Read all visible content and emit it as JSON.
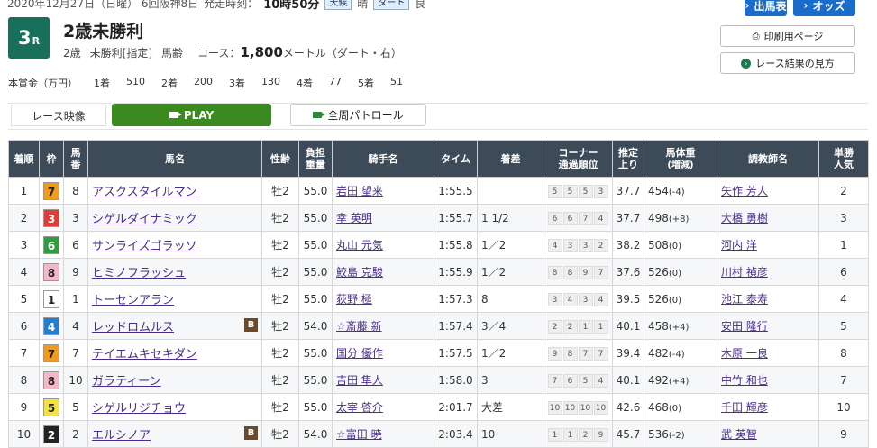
{
  "race": {
    "date_line": "2020年12月27日（日曜） 6回阪神8日",
    "start_label": "発走時刻：",
    "start_time": "10時50分",
    "weather_tag": "天候",
    "weather": "晴",
    "track_tag": "ダート",
    "track_state": "良",
    "number": "3",
    "number_suffix": "R",
    "name": "2歳未勝利",
    "cond_age": "2歳",
    "cond_class": "未勝利[指定]",
    "cond_weight": "馬齢",
    "course_label": "コース：",
    "distance": "1,800",
    "distance_unit": "メートル（ダート・右）"
  },
  "prize": {
    "label": "本賞金（万円）",
    "items": [
      {
        "place": "1着",
        "value": "510"
      },
      {
        "place": "2着",
        "value": "200"
      },
      {
        "place": "3着",
        "value": "130"
      },
      {
        "place": "4着",
        "value": "77"
      },
      {
        "place": "5着",
        "value": "51"
      }
    ]
  },
  "buttons": {
    "entries": "出馬表",
    "odds": "オッズ",
    "print": "印刷用ページ",
    "howto": "レース結果の見方"
  },
  "video": {
    "label": "レース映像",
    "play": "PLAY",
    "patrol": "全周パトロール"
  },
  "headers": {
    "rank": "着順",
    "waku": "枠",
    "num_a": "馬",
    "num_b": "番",
    "horse": "馬名",
    "sexage": "性齢",
    "wt_a": "負担",
    "wt_b": "重量",
    "jockey": "騎手名",
    "time": "タイム",
    "margin": "着差",
    "corner_a": "コーナー",
    "corner_b": "通過順位",
    "last_a": "推定",
    "last_b": "上り",
    "bw_a": "馬体重",
    "bw_b": "(増減)",
    "trainer": "調教師名",
    "pop_a": "単勝",
    "pop_b": "人気"
  },
  "colors": {
    "header_bg": "#3d4a57",
    "race_badge": "#19705a",
    "play_btn": "#3b8a1f",
    "blue_btn": "#1a6ccb"
  },
  "rows": [
    {
      "rank": "1",
      "waku": "7",
      "num": "8",
      "horse": "アスクスタイルマン",
      "blinker": "",
      "sex": "牡2",
      "wt": "55.0",
      "jockey": "岩田 望来",
      "time": "1:55.5",
      "margin": "",
      "corners": [
        "5",
        "5",
        "5",
        "3"
      ],
      "last": "37.7",
      "bw": "454",
      "bwd": "(-4)",
      "trainer": "矢作 芳人",
      "pop": "2"
    },
    {
      "rank": "2",
      "waku": "3",
      "num": "3",
      "horse": "シゲルダイナミック",
      "blinker": "",
      "sex": "牡2",
      "wt": "55.0",
      "jockey": "幸 英明",
      "time": "1:55.7",
      "margin": "1 1/2",
      "corners": [
        "6",
        "6",
        "7",
        "4"
      ],
      "last": "37.7",
      "bw": "498",
      "bwd": "(+8)",
      "trainer": "大橋 勇樹",
      "pop": "3"
    },
    {
      "rank": "3",
      "waku": "6",
      "num": "6",
      "horse": "サンライズゴラッソ",
      "blinker": "",
      "sex": "牡2",
      "wt": "55.0",
      "jockey": "丸山 元気",
      "time": "1:55.8",
      "margin": "1／2",
      "corners": [
        "4",
        "3",
        "3",
        "2"
      ],
      "last": "38.2",
      "bw": "508",
      "bwd": "(0)",
      "trainer": "河内 洋",
      "pop": "1"
    },
    {
      "rank": "4",
      "waku": "8",
      "num": "9",
      "horse": "ヒミノフラッシュ",
      "blinker": "",
      "sex": "牡2",
      "wt": "55.0",
      "jockey": "鮫島 克駿",
      "time": "1:55.9",
      "margin": "1／2",
      "corners": [
        "8",
        "8",
        "9",
        "7"
      ],
      "last": "37.6",
      "bw": "526",
      "bwd": "(0)",
      "trainer": "川村 禎彦",
      "pop": "6"
    },
    {
      "rank": "5",
      "waku": "1",
      "num": "1",
      "horse": "トーセンアラン",
      "blinker": "",
      "sex": "牡2",
      "wt": "55.0",
      "jockey": "荻野 極",
      "time": "1:57.3",
      "margin": "8",
      "corners": [
        "3",
        "4",
        "3",
        "4"
      ],
      "last": "39.5",
      "bw": "526",
      "bwd": "(0)",
      "trainer": "池江 泰寿",
      "pop": "4"
    },
    {
      "rank": "6",
      "waku": "4",
      "num": "4",
      "horse": "レッドロムルス",
      "blinker": "B",
      "sex": "牡2",
      "wt": "54.0",
      "jockey": "☆斎藤 新",
      "time": "1:57.4",
      "margin": "3／4",
      "corners": [
        "2",
        "2",
        "1",
        "1"
      ],
      "last": "40.1",
      "bw": "458",
      "bwd": "(+4)",
      "trainer": "安田 隆行",
      "pop": "5"
    },
    {
      "rank": "7",
      "waku": "7",
      "num": "7",
      "horse": "テイエムキセキダン",
      "blinker": "",
      "sex": "牡2",
      "wt": "55.0",
      "jockey": "国分 優作",
      "time": "1:57.5",
      "margin": "1／2",
      "corners": [
        "9",
        "8",
        "7",
        "7"
      ],
      "last": "39.4",
      "bw": "482",
      "bwd": "(-4)",
      "trainer": "木原 一良",
      "pop": "8"
    },
    {
      "rank": "8",
      "waku": "8",
      "num": "10",
      "horse": "ガラティーン",
      "blinker": "",
      "sex": "牡2",
      "wt": "55.0",
      "jockey": "吉田 隼人",
      "time": "1:58.0",
      "margin": "3",
      "corners": [
        "7",
        "6",
        "5",
        "4"
      ],
      "last": "40.1",
      "bw": "492",
      "bwd": "(+4)",
      "trainer": "中竹 和也",
      "pop": "7"
    },
    {
      "rank": "9",
      "waku": "5",
      "num": "5",
      "horse": "シゲルリジチョウ",
      "blinker": "",
      "sex": "牡2",
      "wt": "55.0",
      "jockey": "太宰 啓介",
      "time": "2:01.7",
      "margin": "大差",
      "corners": [
        "10",
        "10",
        "10",
        "10"
      ],
      "last": "42.6",
      "bw": "468",
      "bwd": "(0)",
      "trainer": "千田 輝彦",
      "pop": "10"
    },
    {
      "rank": "10",
      "waku": "2",
      "num": "2",
      "horse": "エルシノア",
      "blinker": "B",
      "sex": "牡2",
      "wt": "54.0",
      "jockey": "☆富田 暁",
      "time": "2:03.4",
      "margin": "10",
      "corners": [
        "1",
        "1",
        "2",
        "9"
      ],
      "last": "45.7",
      "bw": "536",
      "bwd": "(-2)",
      "trainer": "武 英智",
      "pop": "9"
    }
  ]
}
